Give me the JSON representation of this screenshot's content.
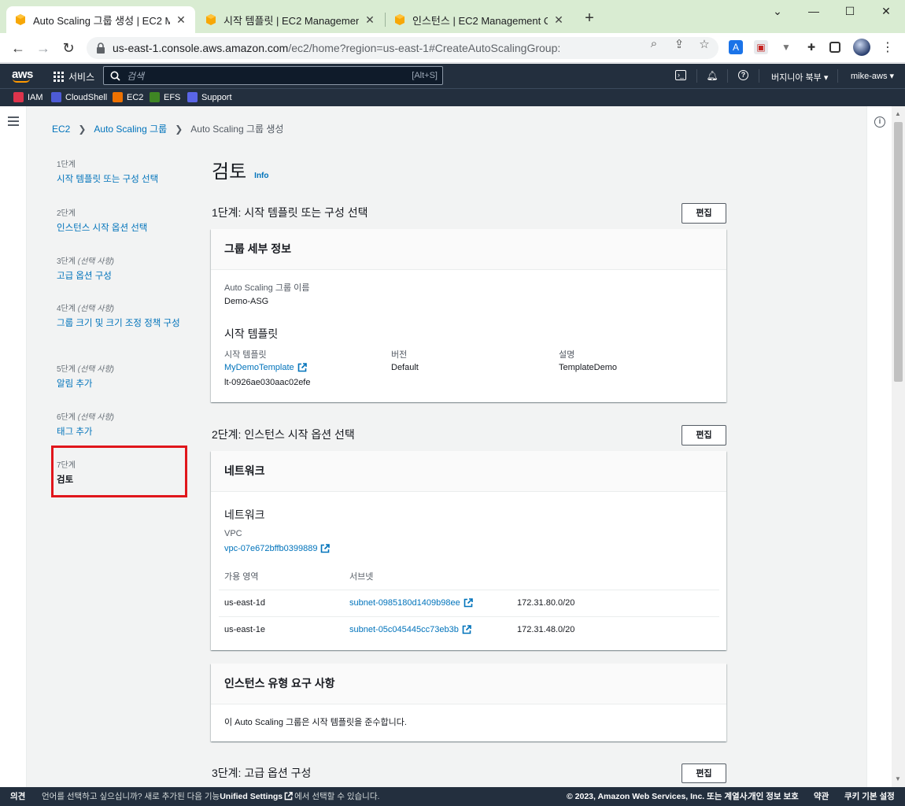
{
  "browser": {
    "tabs": [
      {
        "title": "Auto Scaling 그룹 생성 | EC2 Ma",
        "active": true
      },
      {
        "title": "시작 템플릿 | EC2 Management",
        "active": false
      },
      {
        "title": "인스턴스 | EC2 Management Co",
        "active": false
      }
    ],
    "url_host": "us-east-1.console.aws.amazon.com",
    "url_path": "/ec2/home?region=us-east-1#CreateAutoScalingGroup:"
  },
  "aws_header": {
    "logo": "aws",
    "services_label": "서비스",
    "search_placeholder": "검색",
    "search_shortcut": "[Alt+S]",
    "region": "버지니아 북부 ▾",
    "account": "mike-aws ▾"
  },
  "favorites": [
    {
      "label": "IAM",
      "color": "#dd344c"
    },
    {
      "label": "CloudShell",
      "color": "#4d5bd6"
    },
    {
      "label": "EC2",
      "color": "#ed7100"
    },
    {
      "label": "EFS",
      "color": "#3f8624"
    },
    {
      "label": "Support",
      "color": "#5a65e6"
    }
  ],
  "breadcrumb": {
    "items": [
      "EC2",
      "Auto Scaling 그룹"
    ],
    "current": "Auto Scaling 그룹 생성"
  },
  "steps": [
    {
      "num": "1단계",
      "optional": "",
      "label": "시작 템플릿 또는 구성 선택"
    },
    {
      "num": "2단계",
      "optional": "",
      "label": "인스턴스 시작 옵션 선택"
    },
    {
      "num": "3단계",
      "optional": "(선택 사항)",
      "label": "고급 옵션 구성"
    },
    {
      "num": "4단계",
      "optional": "(선택 사항)",
      "label": "그룹 크기 및 크기 조정 정책 구성"
    },
    {
      "num": "5단계",
      "optional": "(선택 사항)",
      "label": "알림 추가"
    },
    {
      "num": "6단계",
      "optional": "(선택 사항)",
      "label": "태그 추가"
    },
    {
      "num": "7단계",
      "optional": "",
      "label": "검토"
    }
  ],
  "page": {
    "title": "검토",
    "info": "Info",
    "edit_label": "편집"
  },
  "section1": {
    "heading": "1단계: 시작 템플릿 또는 구성 선택",
    "card_title": "그룹 세부 정보",
    "asg_name_label": "Auto Scaling 그룹 이름",
    "asg_name": "Demo-ASG",
    "lt_heading": "시작 템플릿",
    "lt_label": "시작 템플릿",
    "lt_name": "MyDemoTemplate",
    "lt_id": "lt-0926ae030aac02efe",
    "version_label": "버전",
    "version": "Default",
    "desc_label": "설명",
    "desc": "TemplateDemo"
  },
  "section2": {
    "heading": "2단계: 인스턴스 시작 옵션 선택",
    "card_title": "네트워크",
    "network_heading": "네트워크",
    "vpc_label": "VPC",
    "vpc": "vpc-07e672bffb0399889",
    "col_az": "가용 영역",
    "col_subnet": "서브넷",
    "rows": [
      {
        "az": "us-east-1d",
        "subnet": "subnet-0985180d1409b98ee",
        "cidr": "172.31.80.0/20"
      },
      {
        "az": "us-east-1e",
        "subnet": "subnet-05c045445cc73eb3b",
        "cidr": "172.31.48.0/20"
      }
    ],
    "req_title": "인스턴스 유형 요구 사항",
    "req_text": "이 Auto Scaling 그룹은 시작 템플릿을 준수합니다."
  },
  "section3": {
    "heading": "3단계: 고급 옵션 구성"
  },
  "footer": {
    "feedback": "의견",
    "lang_pre": "언어를 선택하고 싶으십니까? 새로 추가된 다음 기능",
    "unified": "Unified Settings",
    "lang_post": "에서 선택할 수 있습니다.",
    "copyright": "© 2023, Amazon Web Services, Inc. 또는 계열사.",
    "privacy": "개인 정보 보호",
    "terms": "약관",
    "cookies": "쿠키 기본 설정"
  },
  "colors": {
    "aws_header": "#232f3e",
    "link": "#0073bb",
    "aws_orange": "#ff9900",
    "highlight_box": "#e0161b",
    "tab_strip": "#d9ecd2"
  }
}
